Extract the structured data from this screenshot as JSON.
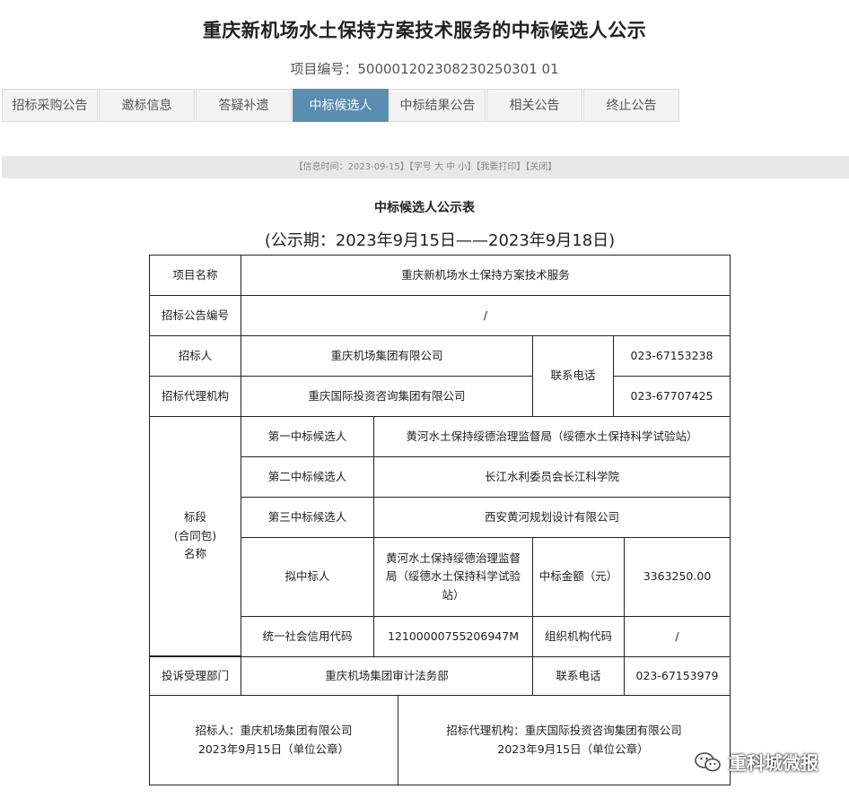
{
  "page": {
    "title": "重庆新机场水土保持方案技术服务的中标候选人公示",
    "project_no_label": "项目编号：",
    "project_no": "500001202308230250301 01"
  },
  "tabs": [
    "招标采购公告",
    "邀标信息",
    "答疑补遗",
    "中标候选人",
    "中标结果公告",
    "相关公告",
    "终止公告"
  ],
  "active_tab": 3,
  "info_bar": {
    "text": "【信息时间：2023-09-15】【字号 大 中 小】【我要打印】【关闭】"
  },
  "table": {
    "title": "中标候选人公示表",
    "period": "(公示期：2023年9月15日——2023年9月18日)",
    "project_name_label": "项目名称",
    "project_name": "重庆新机场水土保持方案技术服务",
    "notice_no_label": "招标公告编号",
    "notice_no": "/",
    "tenderer_label": "招标人",
    "tenderer": "重庆机场集团有限公司",
    "contact_phone_label": "联系电话",
    "tenderer_phone": "023-67153238",
    "agency_label": "招标代理机构",
    "agency": "重庆国际投资咨询集团有限公司",
    "agency_phone": "023-67707425",
    "lot_label_lines": [
      "标段",
      "(合同包)",
      "名称"
    ],
    "candidate1_label": "第一中标候选人",
    "candidate1": "黄河水土保持绥德治理监督局（绥德水土保持科学试验站）",
    "candidate2_label": "第二中标候选人",
    "candidate2": "长江水利委员会长江科学院",
    "candidate3_label": "第三中标候选人",
    "candidate3": "西安黄河规划设计有限公司",
    "proposed_label": "拟中标人",
    "proposed_lines": [
      "黄河水土保持绥德治理监督",
      "局（绥德水土保持科学试验",
      "站）"
    ],
    "amount_label": "中标金额（元）",
    "amount": "3363250.00",
    "credit_code_label": "统一社会信用代码",
    "credit_code": "12100000755206947M",
    "org_code_label": "组织机构代码",
    "org_code": "/",
    "complaint_label": "投诉受理部门",
    "complaint_dept": "重庆机场集团审计法务部",
    "complaint_phone_label": "联系电话",
    "complaint_phone": "023-67153979",
    "sign_tenderer_line1": "招标人：重庆机场集团有限公司",
    "sign_tenderer_line2": "2023年9月15日（单位公章）",
    "sign_agency_line1": "招标代理机构：重庆国际投资咨询集团有限公司",
    "sign_agency_line2": "2023年9月15日（单位公章）"
  },
  "watermark": {
    "text": "重科城微报",
    "icon": "wechat-icon"
  }
}
